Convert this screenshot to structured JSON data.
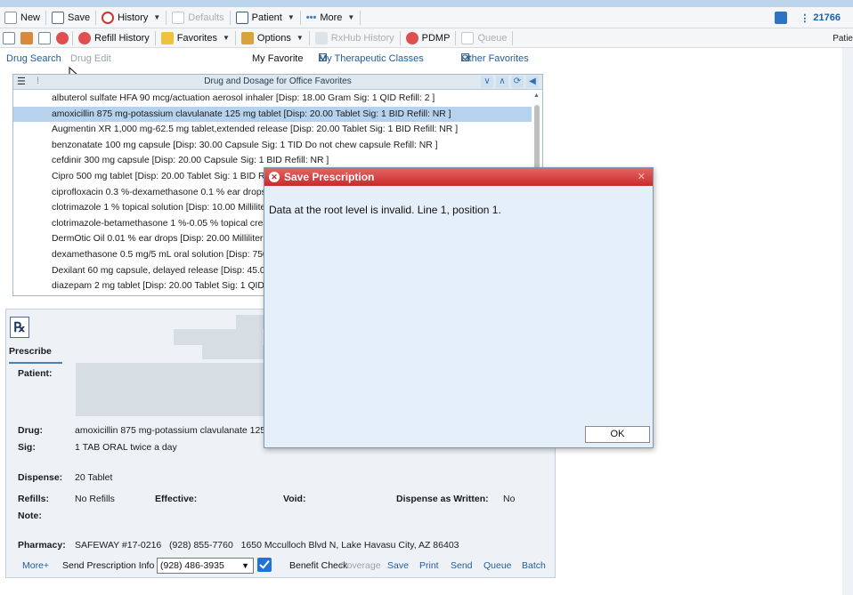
{
  "toolbar1": {
    "new": "New",
    "save": "Save",
    "history": "History",
    "defaults": "Defaults",
    "patient": "Patient",
    "more": "More",
    "account_id": "21766"
  },
  "toolbar2": {
    "refill_history": "Refill History",
    "favorites": "Favorites",
    "options": "Options",
    "rxhub_history": "RxHub History",
    "pdmp": "PDMP",
    "queue": "Queue",
    "patient_cut": "Patie"
  },
  "drug_tabs": {
    "drug_search": "Drug Search",
    "drug_edit": "Drug Edit",
    "my_favorite": "My Favorite",
    "my_therapeutic_classes": "My Therapeutic Classes",
    "other_favorites": "Other Favorites"
  },
  "favorites_panel": {
    "title": "Drug and Dosage for Office Favorites",
    "items": [
      "albuterol sulfate HFA 90 mcg/actuation aerosol inhaler [Disp: 18.00 Gram Sig: 1 QID Refill: 2 ]",
      "amoxicillin 875 mg-potassium clavulanate 125 mg tablet [Disp: 20.00 Tablet Sig: 1 BID Refill: NR ]",
      "Augmentin XR 1,000 mg-62.5 mg tablet,extended release [Disp: 20.00 Tablet Sig: 1 BID Refill: NR ]",
      "benzonatate 100 mg capsule [Disp: 30.00 Capsule Sig: 1 TID Do not chew capsule Refill: NR ]",
      "cefdinir 300 mg capsule [Disp: 20.00 Capsule Sig: 1 BID Refill: NR ]",
      "Cipro 500 mg tablet [Disp: 20.00 Tablet Sig: 1 BID R",
      "ciprofloxacin 0.3 %-dexamethasone 0.1 % ear drops",
      "clotrimazole 1 % topical solution [Disp: 10.00 Millilite",
      "clotrimazole-betamethasone 1 %-0.05 % topical crea",
      "DermOtic Oil 0.01 % ear drops [Disp: 20.00 Milliliter",
      "dexamethasone 0.5 mg/5 mL oral solution [Disp: 750",
      "Dexilant 60 mg capsule, delayed release [Disp: 45.0",
      "diazepam 2 mg tablet [Disp: 20.00 Tablet Sig: 1 QID"
    ],
    "selected_index": 1
  },
  "prescribe": {
    "logo": "℞",
    "label": "Prescribe",
    "patient_label": "Patient:",
    "drug_label": "Drug:",
    "drug_value": "amoxicillin 875 mg-potassium clavulanate 125",
    "sig_label": "Sig:",
    "sig_value": "1 TAB ORAL twice a day",
    "dispense_label": "Dispense:",
    "dispense_value": "20 Tablet",
    "refills_label": "Refills:",
    "refills_value": "No Refills",
    "effective_label": "Effective:",
    "void_label": "Void:",
    "daw_label": "Dispense as Written:",
    "daw_value": "No",
    "note_label": "Note:",
    "pharmacy_label": "Pharmacy:",
    "pharmacy_value": "SAFEWAY #17-0216   (928) 855-7760   1650 Mcculloch Blvd N, Lake Havasu City, AZ 86403",
    "more_link": "More+",
    "send_info_label": "Send Prescription Info",
    "send_info_value": "(928) 486-3935",
    "benefit_check": "Benefit Check",
    "actions": {
      "coverage": "Coverage",
      "save": "Save",
      "print": "Print",
      "send": "Send",
      "queue": "Queue",
      "batch": "Batch"
    }
  },
  "dialog": {
    "title": "Save Prescription",
    "message": "Data at the root level is invalid. Line 1, position 1.",
    "ok": "OK"
  },
  "colors": {
    "accent": "#1f5d99",
    "selection": "#b7d2ee",
    "dialog_title": "#d0393a",
    "dialog_body": "#e5effa"
  }
}
